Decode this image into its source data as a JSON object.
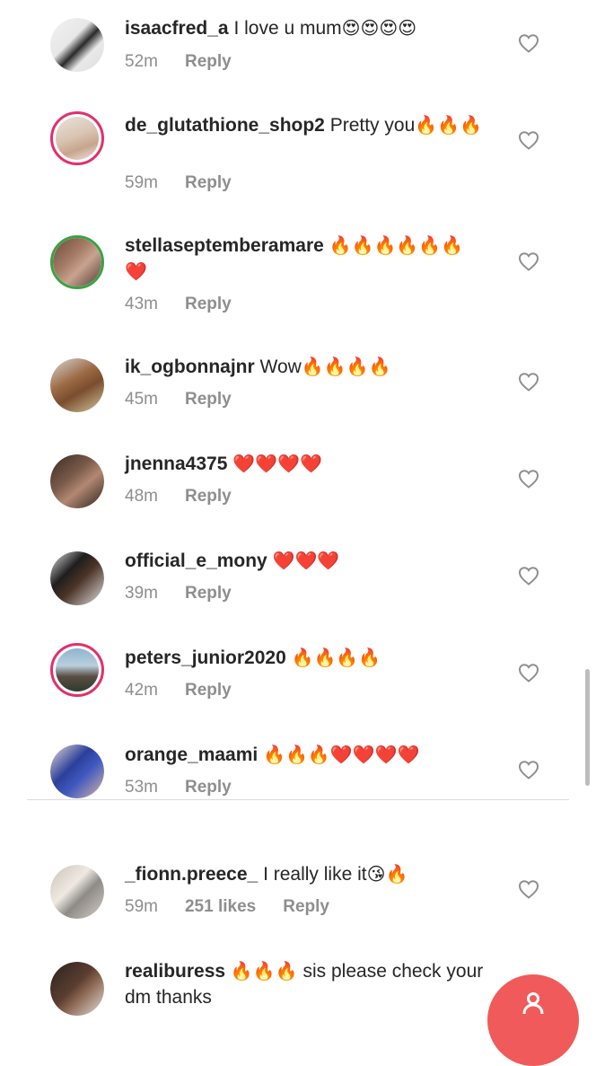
{
  "comments": [
    {
      "username": "isaacfred_a",
      "text": "I love u mum",
      "emoji": "😍😍😍😍",
      "time": "52m",
      "reply": "Reply"
    },
    {
      "username": "de_glutathione_shop2",
      "text": "Pretty you",
      "emoji": "🔥🔥🔥",
      "time": "59m",
      "reply": "Reply"
    },
    {
      "username": "stellaseptemberamare",
      "text": "",
      "emoji": "🔥🔥🔥🔥🔥🔥❤️",
      "time": "43m",
      "reply": "Reply"
    },
    {
      "username": "ik_ogbonnajnr",
      "text": "Wow",
      "emoji": "🔥🔥🔥🔥",
      "time": "45m",
      "reply": "Reply"
    },
    {
      "username": "jnenna4375",
      "text": "",
      "emoji": "❤️❤️❤️❤️",
      "time": "48m",
      "reply": "Reply"
    },
    {
      "username": "official_e_mony",
      "text": "",
      "emoji": "❤️❤️❤️",
      "time": "39m",
      "reply": "Reply"
    },
    {
      "username": "peters_junior2020",
      "text": "",
      "emoji": "🔥🔥🔥🔥",
      "time": "42m",
      "reply": "Reply"
    },
    {
      "username": "orange_maami",
      "text": "",
      "emoji": "🔥🔥🔥❤️❤️❤️❤️",
      "time": "53m",
      "reply": "Reply"
    },
    {
      "username": "_fionn.preece_",
      "text": "I really like it",
      "emoji": "😘🔥",
      "time": "59m",
      "likes": "251 likes",
      "reply": "Reply"
    },
    {
      "username": "realiburess",
      "text": "sis please check your dm thanks",
      "emoji": "🔥🔥🔥",
      "time": "",
      "reply": ""
    }
  ],
  "colors": {
    "accent": "#e1306c",
    "fab": "#f05a5a",
    "meta": "#8e8e8e"
  },
  "icons": {
    "like": "heart-outline-icon",
    "fab": "person-icon"
  }
}
